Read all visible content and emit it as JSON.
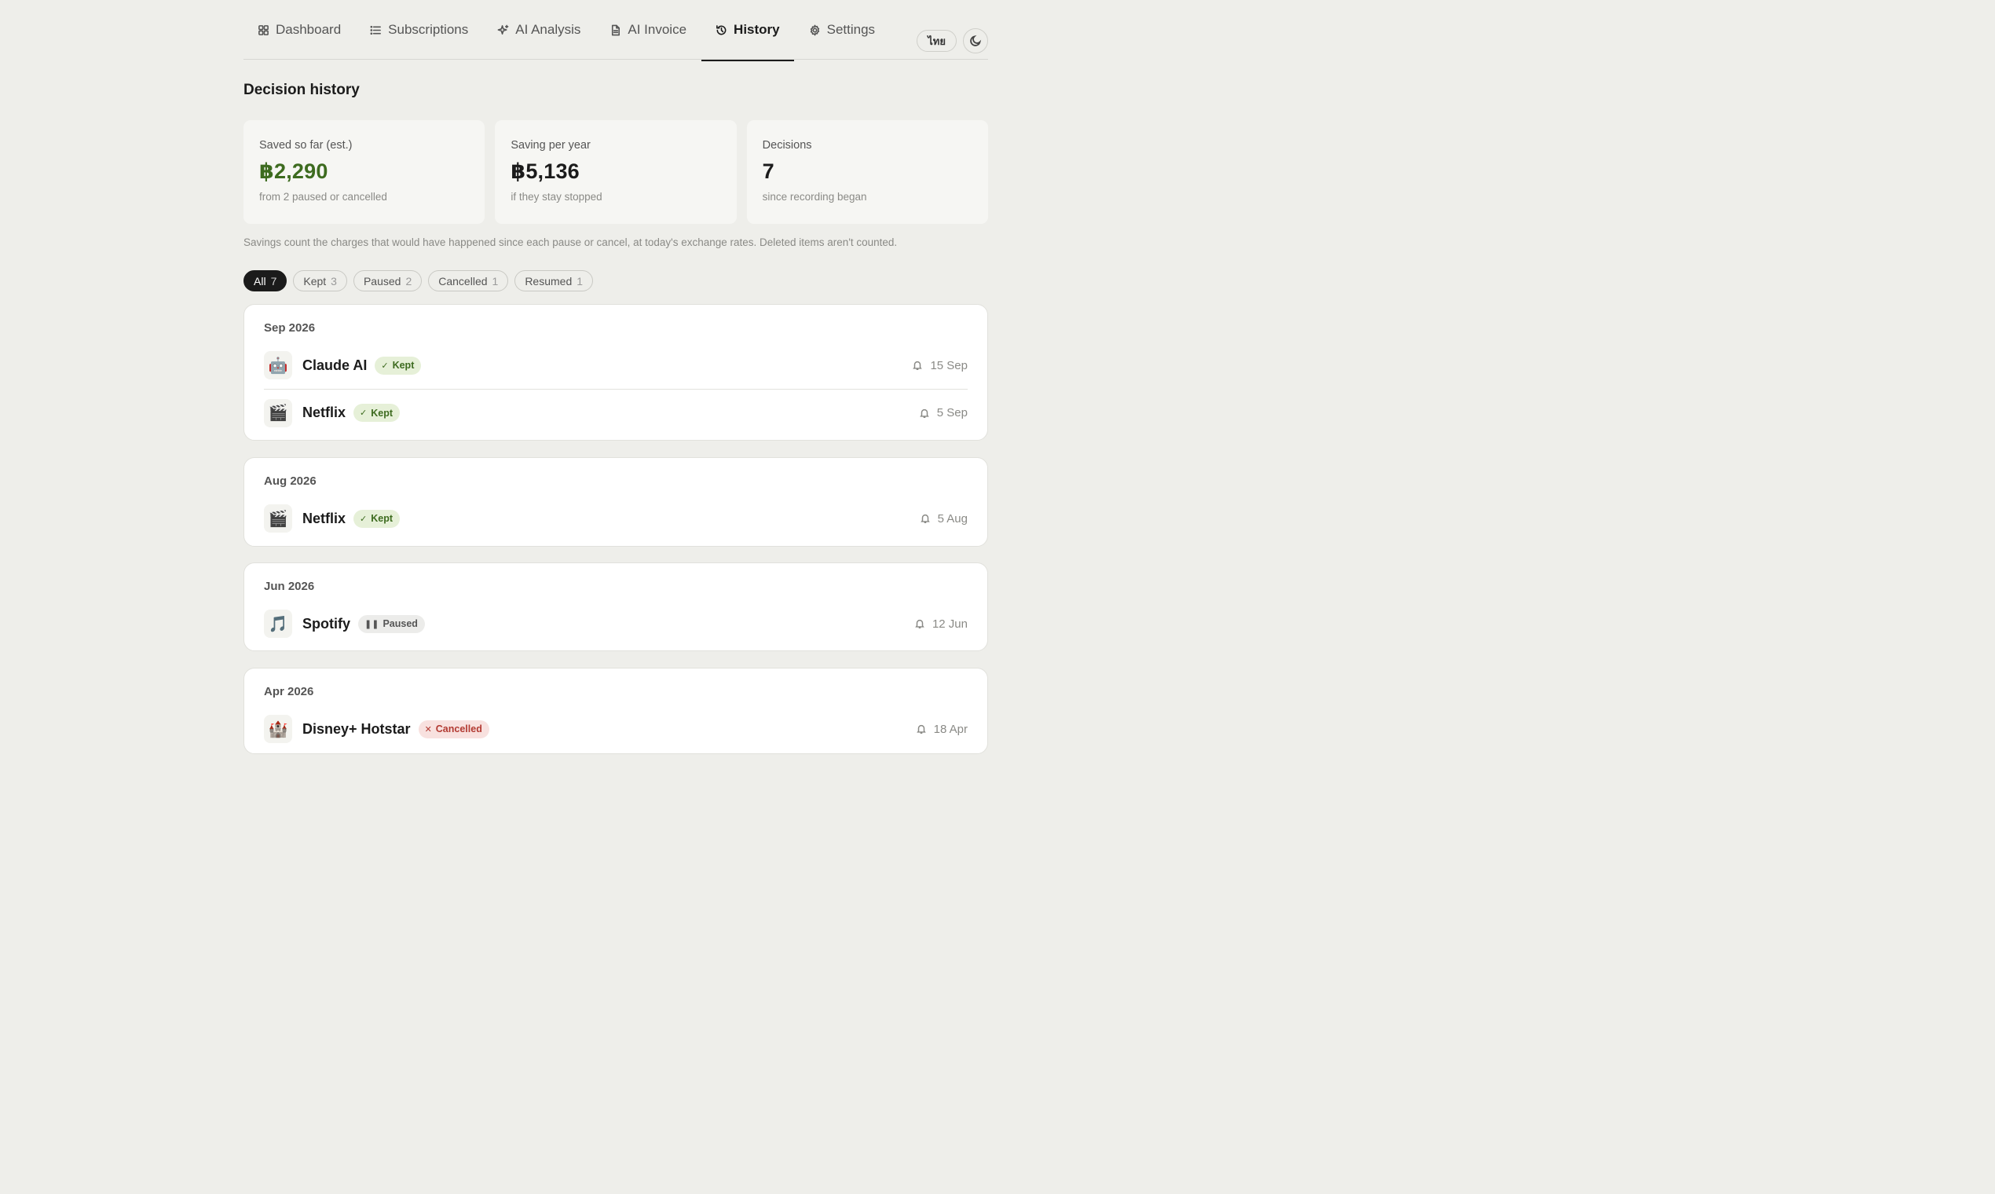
{
  "nav": {
    "tabs": [
      {
        "label": "Dashboard",
        "icon": "grid-icon"
      },
      {
        "label": "Subscriptions",
        "icon": "list-icon"
      },
      {
        "label": "AI Analysis",
        "icon": "sparkle-icon"
      },
      {
        "label": "AI Invoice",
        "icon": "document-icon"
      },
      {
        "label": "History",
        "icon": "history-icon",
        "active": true
      },
      {
        "label": "Settings",
        "icon": "gear-icon"
      }
    ],
    "language_label": "ไทย",
    "theme_icon": "moon-icon"
  },
  "page": {
    "title": "Decision history",
    "note": "Savings count the charges that would have happened since each pause or cancel, at today's exchange rates. Deleted items aren't counted."
  },
  "stats": [
    {
      "label": "Saved so far (est.)",
      "value": "฿2,290",
      "sub": "from 2 paused or cancelled",
      "accent": "#3d6b1f"
    },
    {
      "label": "Saving per year",
      "value": "฿5,136",
      "sub": "if they stay stopped"
    },
    {
      "label": "Decisions",
      "value": "7",
      "sub": "since recording began"
    }
  ],
  "filters": [
    {
      "label": "All",
      "count": "7",
      "active": true
    },
    {
      "label": "Kept",
      "count": "3"
    },
    {
      "label": "Paused",
      "count": "2"
    },
    {
      "label": "Cancelled",
      "count": "1"
    },
    {
      "label": "Resumed",
      "count": "1"
    }
  ],
  "groups": [
    {
      "month": "Sep 2026",
      "items": [
        {
          "name": "Claude AI",
          "logo": "🤖",
          "status": "Kept",
          "date": "15 Sep"
        },
        {
          "name": "Netflix",
          "logo": "🎬",
          "status": "Kept",
          "date": "5 Sep"
        }
      ]
    },
    {
      "month": "Aug 2026",
      "items": [
        {
          "name": "Netflix",
          "logo": "🎬",
          "status": "Kept",
          "date": "5 Aug"
        }
      ]
    },
    {
      "month": "Jun 2026",
      "items": [
        {
          "name": "Spotify",
          "logo": "🎵",
          "status": "Paused",
          "date": "12 Jun"
        }
      ]
    },
    {
      "month": "Apr 2026",
      "items": [
        {
          "name": "Disney+ Hotstar",
          "logo": "🏰",
          "status": "Cancelled",
          "date": "18 Apr"
        }
      ]
    }
  ],
  "colors": {
    "background": "#eeeeea",
    "kept": "#3d6b1f",
    "cancelled": "#b23a32",
    "active_chip": "#1b1b1b"
  }
}
